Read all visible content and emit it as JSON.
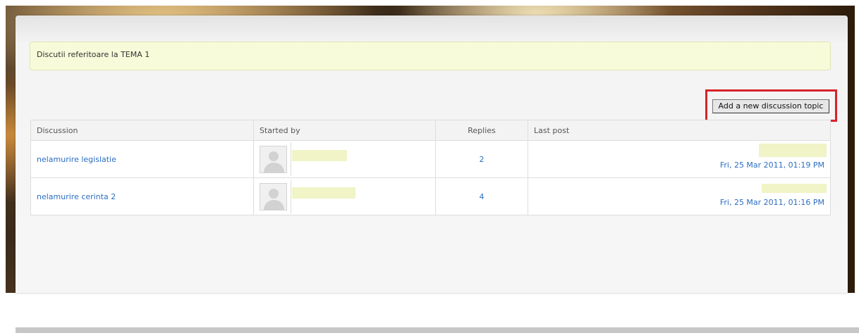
{
  "intro": {
    "text": "Discutii referitoare la TEMA 1"
  },
  "toolbar": {
    "add_topic_label": "Add a new discussion topic"
  },
  "table": {
    "headers": {
      "discussion": "Discussion",
      "started_by": "Started by",
      "replies": "Replies",
      "last_post": "Last post"
    },
    "rows": [
      {
        "discussion": "nelamurire legislatie",
        "replies": "2",
        "last_post_date": "Fri, 25 Mar 2011, 01:19 PM"
      },
      {
        "discussion": "nelamurire cerinta 2",
        "replies": "4",
        "last_post_date": "Fri, 25 Mar 2011, 01:16 PM"
      }
    ]
  },
  "colors": {
    "link": "#2b6ec2",
    "highlight_border": "#d8232a",
    "intro_background": "#f7fbd9"
  },
  "icons": {
    "avatar": "default-user-avatar-icon"
  }
}
